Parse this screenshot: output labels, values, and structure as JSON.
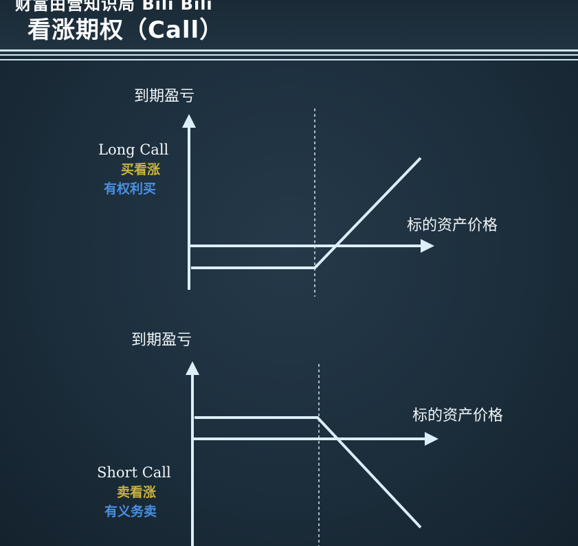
{
  "overlay": {
    "text": "财富由营知识局 Bili Bili"
  },
  "title": "看涨期权（Call）",
  "colors": {
    "line": "#dceef8",
    "dashed": "#d9e6ee",
    "chinese_label": "#c9b33c",
    "rights_label": "#4a8fe0"
  },
  "panels": [
    {
      "y_axis_label": "到期盈亏",
      "x_axis_label": "标的资产价格",
      "position_name": "Long Call",
      "position_cn": "买看涨",
      "position_right": "有权利买",
      "payoff": "long"
    },
    {
      "y_axis_label": "到期盈亏",
      "x_axis_label": "标的资产价格",
      "position_name": "Short Call",
      "position_cn": "卖看涨",
      "position_right": "有义务卖",
      "payoff": "short"
    }
  ]
}
